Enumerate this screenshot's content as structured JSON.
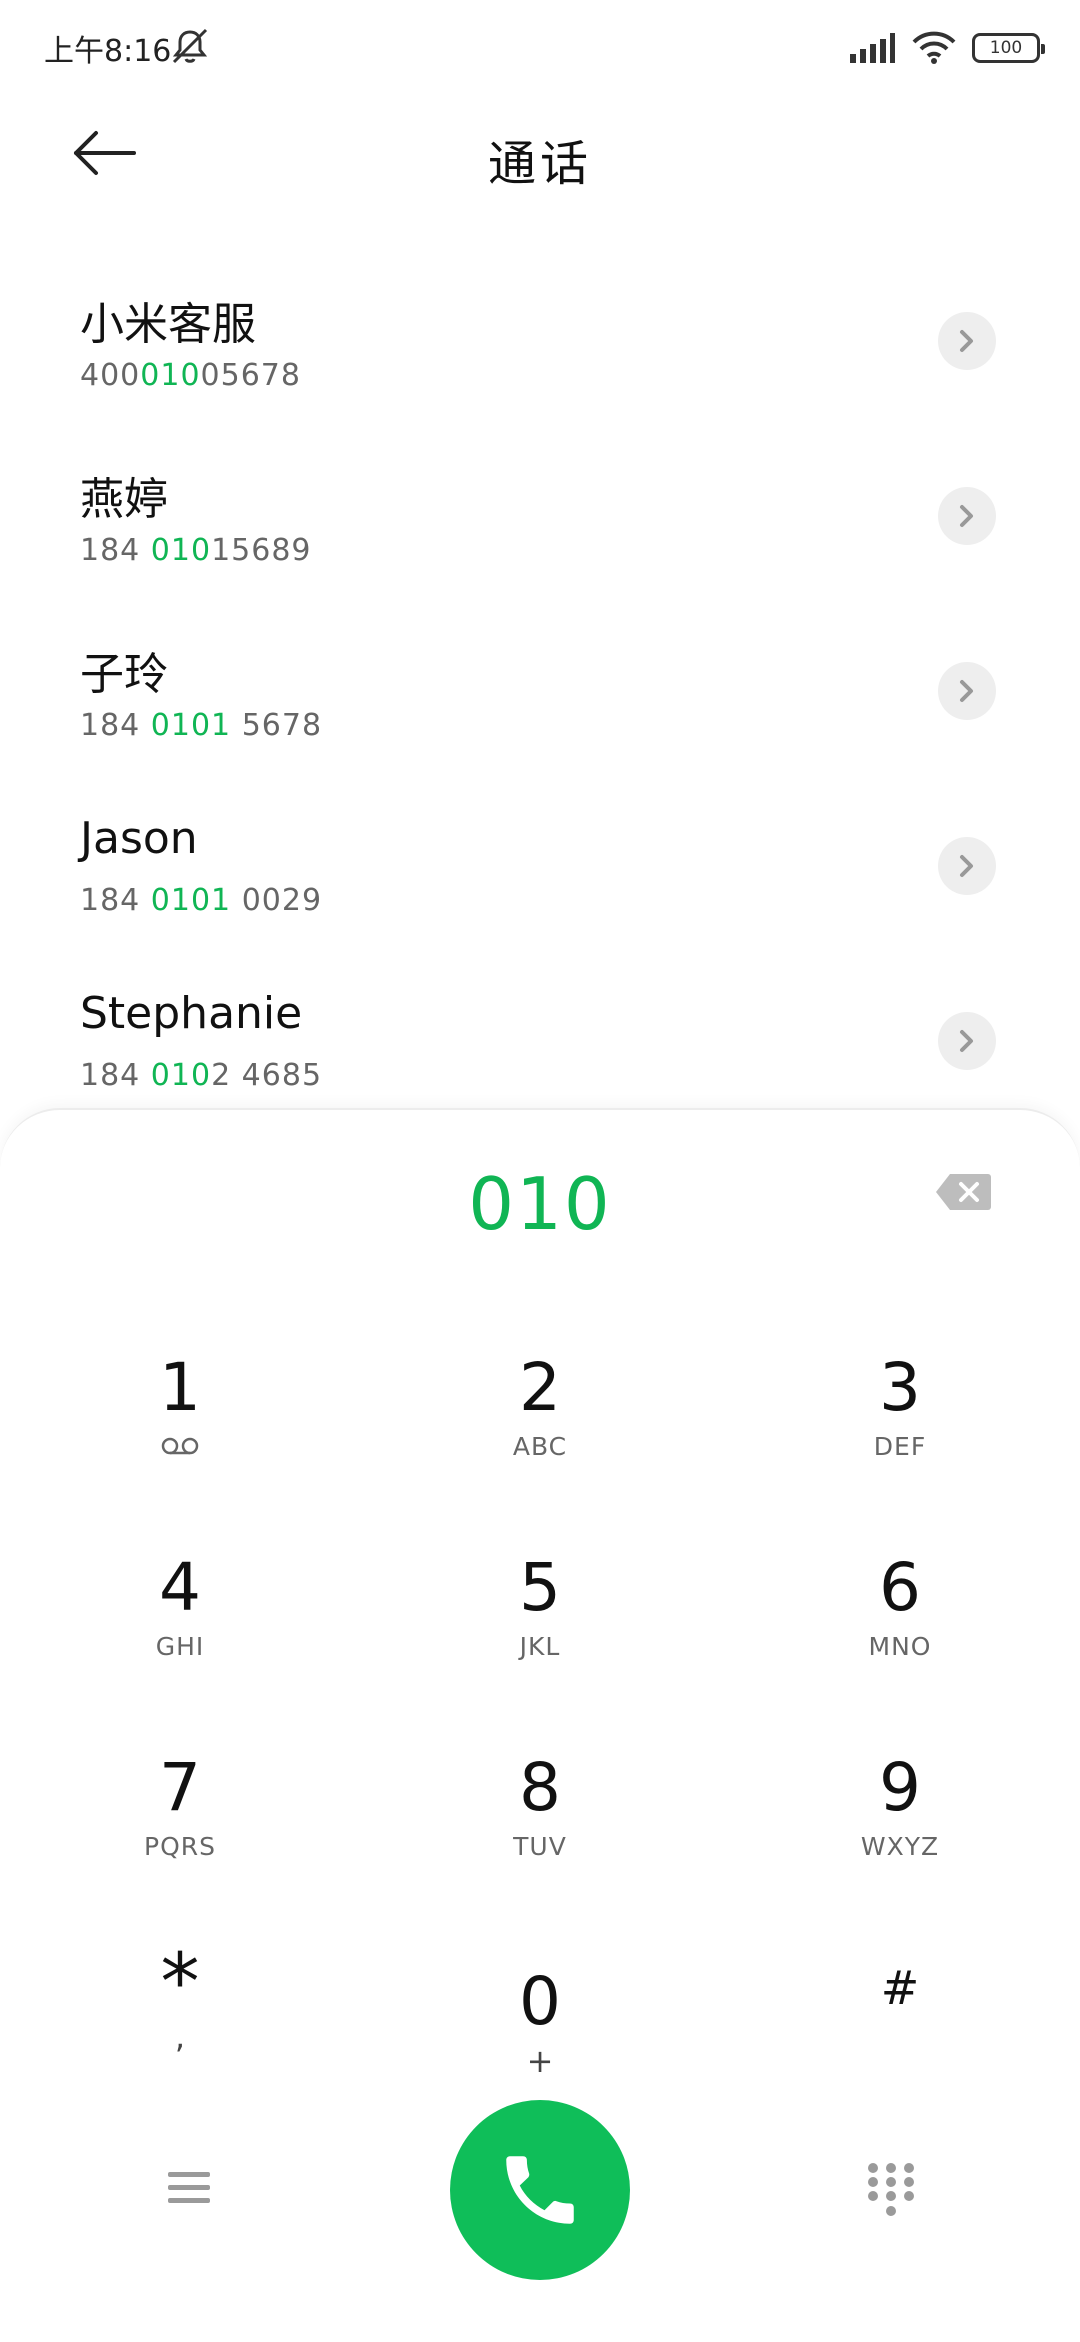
{
  "status_bar": {
    "time": "上午8:16",
    "battery": "100"
  },
  "header": {
    "title": "通话"
  },
  "results": [
    {
      "name": "小米客服",
      "number_parts": [
        "400",
        "010",
        "05678"
      ]
    },
    {
      "name": "燕婷",
      "number_parts": [
        "184 ",
        "010",
        "15689"
      ]
    },
    {
      "name": "子玲",
      "number_parts": [
        "184 ",
        "0101",
        " 5678"
      ]
    },
    {
      "name": "Jason",
      "number_parts": [
        "184 ",
        "0101",
        " 0029"
      ]
    },
    {
      "name": "Stephanie",
      "number_parts": [
        "184 ",
        "010",
        "2 4685"
      ]
    }
  ],
  "dialer": {
    "input": "010",
    "keys": [
      {
        "digit": "1",
        "letters": "",
        "icon": "voicemail-icon"
      },
      {
        "digit": "2",
        "letters": "ABC"
      },
      {
        "digit": "3",
        "letters": "DEF"
      },
      {
        "digit": "4",
        "letters": "GHI"
      },
      {
        "digit": "5",
        "letters": "JKL"
      },
      {
        "digit": "6",
        "letters": "MNO"
      },
      {
        "digit": "7",
        "letters": "PQRS"
      },
      {
        "digit": "8",
        "letters": "TUV"
      },
      {
        "digit": "9",
        "letters": "WXYZ"
      },
      {
        "digit": "*",
        "letters": ","
      },
      {
        "digit": "0",
        "letters": "+"
      },
      {
        "digit": "#",
        "letters": ""
      }
    ]
  },
  "colors": {
    "accent": "#10b554",
    "call_button": "#0fbe59",
    "detail_button_bg": "#eeeeee"
  }
}
